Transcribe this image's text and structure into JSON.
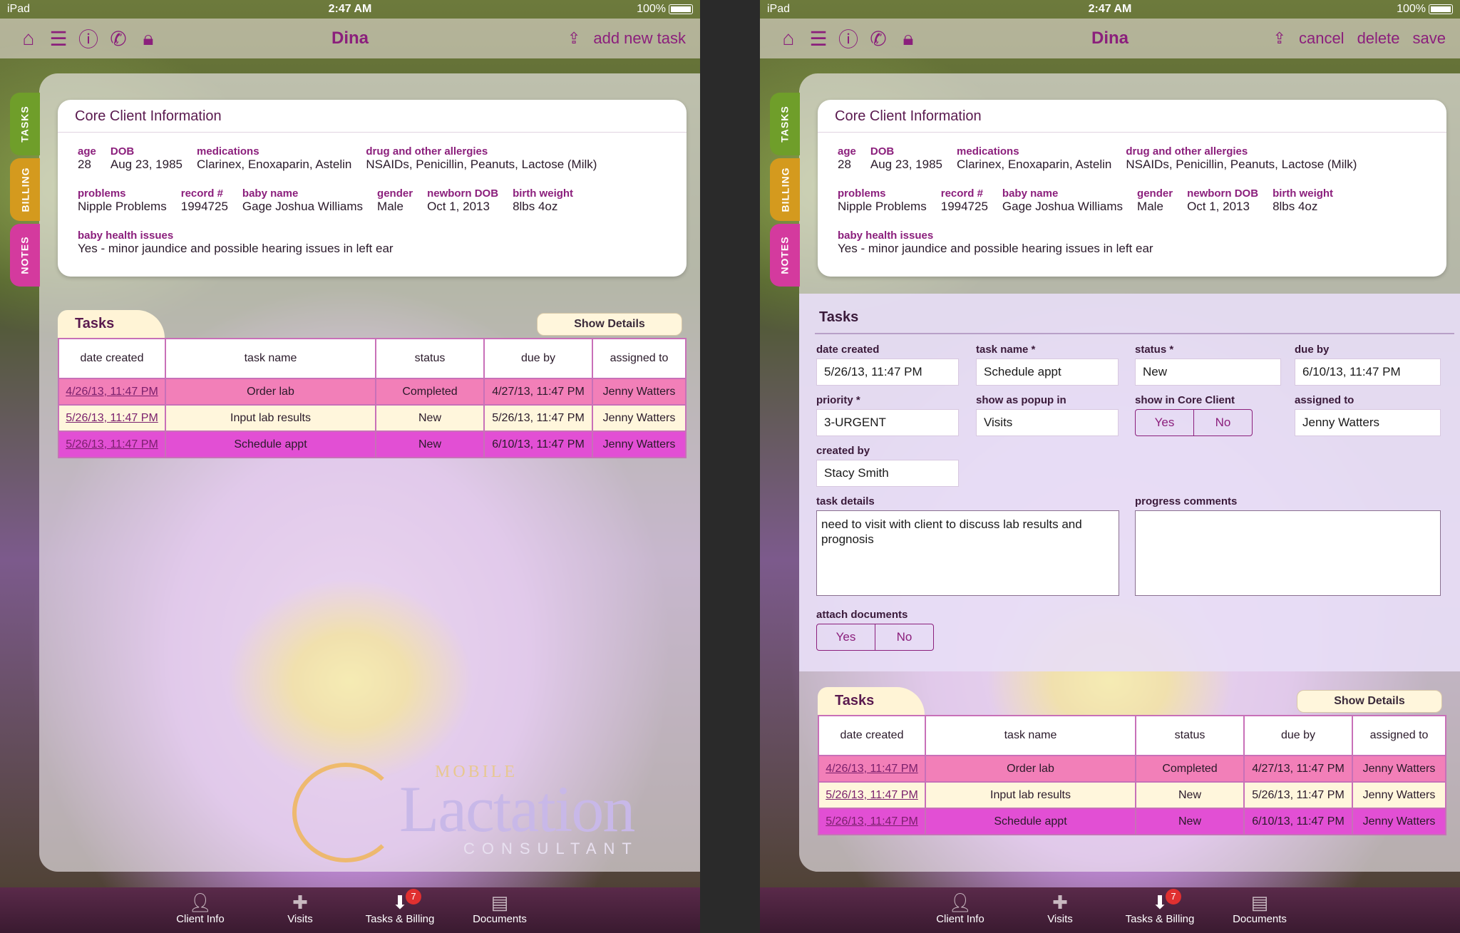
{
  "status": {
    "device": "iPad",
    "time": "2:47 AM",
    "battery": "100%"
  },
  "client_name": "Dina",
  "left_action": "add new task",
  "right_actions": {
    "cancel": "cancel",
    "delete": "delete",
    "save": "save"
  },
  "side_tabs": {
    "tasks": "TASKS",
    "billing": "BILLING",
    "notes": "NOTES"
  },
  "core": {
    "title": "Core Client Information",
    "age": {
      "label": "age",
      "value": "28"
    },
    "dob": {
      "label": "DOB",
      "value": "Aug 23, 1985"
    },
    "medications": {
      "label": "medications",
      "value": "Clarinex, Enoxaparin, Astelin"
    },
    "allergies": {
      "label": "drug and other allergies",
      "value": "NSAIDs, Penicillin, Peanuts, Lactose (Milk)"
    },
    "problems": {
      "label": "problems",
      "value": "Nipple Problems"
    },
    "record": {
      "label": "record #",
      "value": "1994725"
    },
    "baby_name": {
      "label": "baby name",
      "value": "Gage Joshua Williams"
    },
    "gender": {
      "label": "gender",
      "value": "Male"
    },
    "newborn_dob": {
      "label": "newborn DOB",
      "value": "Oct 1, 2013"
    },
    "birth_weight": {
      "label": "birth weight",
      "value": "8lbs 4oz"
    },
    "baby_health": {
      "label": "baby health issues",
      "value": "Yes - minor jaundice and possible hearing issues in left ear"
    }
  },
  "tasks": {
    "title": "Tasks",
    "show_details": "Show Details",
    "headers": {
      "date": "date created",
      "name": "task name",
      "status": "status",
      "due": "due by",
      "assigned": "assigned to"
    },
    "rows": [
      {
        "date": "4/26/13, 11:47 PM",
        "name": "Order lab",
        "status": "Completed",
        "due": "4/27/13, 11:47 PM",
        "assigned": "Jenny Watters",
        "color": "#f27fb8"
      },
      {
        "date": "5/26/13, 11:47 PM",
        "name": "Input lab results",
        "status": "New",
        "due": "5/26/13, 11:47 PM",
        "assigned": "Jenny Watters",
        "color": "#fff6dc"
      },
      {
        "date": "5/26/13, 11:47 PM",
        "name": "Schedule appt",
        "status": "New",
        "due": "6/10/13, 11:47 PM",
        "assigned": "Jenny Watters",
        "color": "#e24fd4"
      }
    ]
  },
  "form": {
    "title": "Tasks",
    "date_created": {
      "label": "date created",
      "value": "5/26/13, 11:47 PM"
    },
    "task_name": {
      "label": "task name *",
      "value": "Schedule appt"
    },
    "status": {
      "label": "status *",
      "value": "New"
    },
    "due_by": {
      "label": "due by",
      "value": "6/10/13, 11:47 PM"
    },
    "priority": {
      "label": "priority *",
      "value": "3-URGENT"
    },
    "popup": {
      "label": "show as popup in",
      "value": "Visits"
    },
    "show_core": {
      "label": "show in Core Client",
      "yes": "Yes",
      "no": "No"
    },
    "assigned": {
      "label": "assigned to",
      "value": "Jenny Watters"
    },
    "created_by": {
      "label": "created by",
      "value": "Stacy Smith"
    },
    "task_details": {
      "label": "task details",
      "value": "need to visit with client to discuss lab results and prognosis"
    },
    "progress": {
      "label": "progress comments",
      "value": ""
    },
    "attach": {
      "label": "attach documents",
      "yes": "Yes",
      "no": "No"
    }
  },
  "logo": {
    "mobile": "MOBILE",
    "lactation": "Lactation",
    "consultant": "CONSULTANT"
  },
  "bottom": {
    "client_info": "Client Info",
    "visits": "Visits",
    "tasks_billing": "Tasks & Billing",
    "documents": "Documents",
    "badge": "7"
  }
}
